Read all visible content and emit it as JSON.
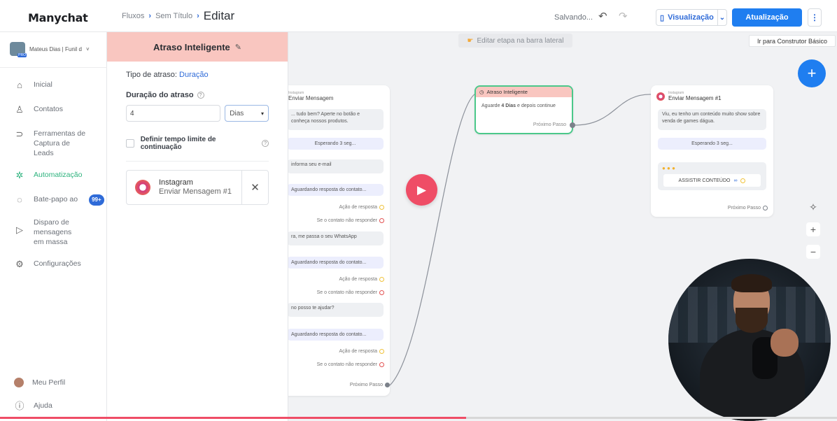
{
  "app": {
    "logo": "Manychat"
  },
  "header": {
    "breadcrumb": [
      "Fluxos",
      "Sem Título"
    ],
    "title": "Editar",
    "status": "Salvando...",
    "preview_label": "Visualização",
    "update_label": "Atualização",
    "more_label": "⋮",
    "tooltip": "Ir para Construtor Básico"
  },
  "sidebar": {
    "account": "Mateus Dias | Funil d",
    "items": [
      {
        "label": "Inicial",
        "icon": "home-icon"
      },
      {
        "label": "Contatos",
        "icon": "user-icon"
      },
      {
        "label": "Ferramentas de Captura de Leads",
        "icon": "magnet-icon"
      },
      {
        "label": "Automatização",
        "icon": "automation-icon"
      },
      {
        "label": "Bate-papo ao",
        "icon": "chat-icon",
        "badge": "99+"
      },
      {
        "label": "Disparo de mensagens em massa",
        "icon": "send-icon"
      },
      {
        "label": "Configurações",
        "icon": "gear-icon"
      }
    ],
    "bottom": [
      {
        "label": "Meu Perfil",
        "icon": "avatar"
      },
      {
        "label": "Ajuda",
        "icon": "help-icon"
      }
    ]
  },
  "panel": {
    "title": "Atraso Inteligente",
    "delay_type_label": "Tipo de atraso:",
    "delay_type_value": "Duração",
    "duration_label": "Duração do atraso",
    "duration_value": "4",
    "unit_value": "Dias",
    "timeout_label": "Definir tempo limite de continuação",
    "next_title": "Instagram",
    "next_sub": "Enviar Mensagem #1"
  },
  "canvas": {
    "hint": "Editar etapa na barra lateral",
    "left_card": {
      "channel": "Instagram",
      "title": "Enviar Mensagem",
      "bubbles": [
        "... tudo bem? Aperte no botão e conheça nossos produtos.",
        "Esperando 3 seg...",
        "informa seu e-mail",
        "Aguardando resposta do contato...",
        "Ação de resposta",
        "Se o contato não responder",
        "ra, me passa o seu WhatsApp",
        "Aguardando resposta do contato...",
        "Ação de resposta",
        "Se o contato não responder",
        "no posso te ajudar?",
        "Aguardando resposta do contato...",
        "Ação de resposta",
        "Se o contato não responder",
        "Próximo Passo"
      ]
    },
    "delay_card": {
      "title": "Atraso Inteligente",
      "body_pre": "Aguarde ",
      "body_bold": "4 Dias",
      "body_post": " e depois continue",
      "next": "Próximo Passo"
    },
    "ig_card": {
      "channel": "Instagram",
      "title": "Enviar Mensagem #1",
      "text": "Viu, eu tenho um conteúdo muito show sobre venda de games dágua.",
      "wait": "Esperando 3 seg...",
      "button": "ASSISTIR CONTEÚDO",
      "next": "Próximo Passo"
    }
  },
  "video": {
    "progress": 0.557
  },
  "colors": {
    "accent": "#1f7ef0",
    "panel_header": "#f9c6c0",
    "active_green": "#2eb37e",
    "play": "#ef4d66"
  }
}
